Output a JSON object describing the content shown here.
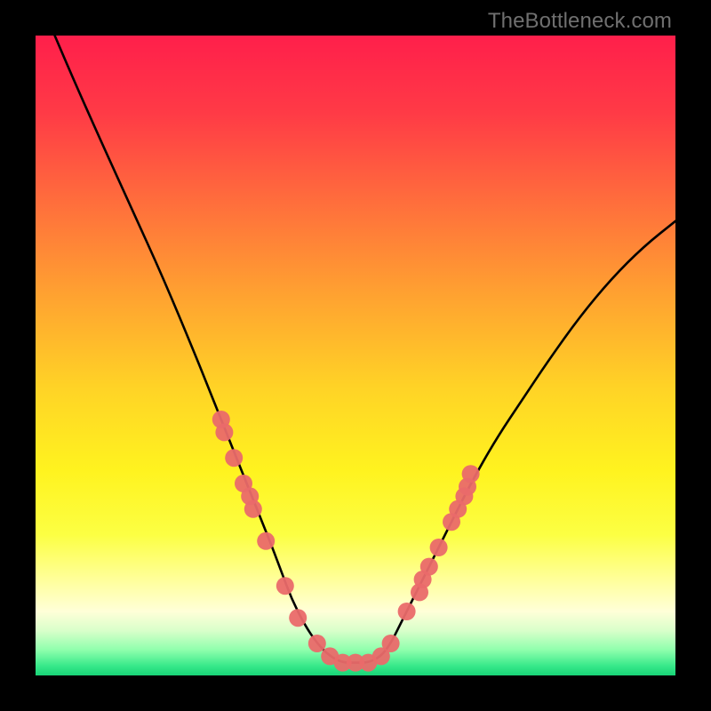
{
  "watermark": "TheBottleneck.com",
  "chart_data": {
    "type": "line",
    "title": "",
    "xlabel": "",
    "ylabel": "",
    "xlim": [
      0,
      100
    ],
    "ylim": [
      0,
      100
    ],
    "grid": false,
    "legend": false,
    "annotations": [],
    "series": [
      {
        "name": "bottleneck-curve",
        "color": "#000000",
        "x": [
          3,
          6,
          10,
          15,
          20,
          25,
          27,
          29,
          31,
          33,
          35,
          37,
          38.5,
          40,
          42,
          44,
          46,
          48,
          50,
          52,
          54,
          55.5,
          57,
          59,
          61,
          64,
          68,
          72,
          76,
          80,
          85,
          90,
          95,
          100
        ],
        "y": [
          100,
          93,
          84,
          73,
          62,
          50,
          45,
          40,
          35,
          30,
          25,
          20,
          16,
          12,
          8,
          5,
          3,
          2,
          2,
          2,
          3,
          5,
          8,
          12,
          16,
          22,
          30,
          37,
          43,
          49,
          56,
          62,
          67,
          71
        ]
      }
    ],
    "markers": [
      {
        "name": "data-dots",
        "color": "#ea6a6a",
        "shape": "circle",
        "radius_px": 10,
        "points": [
          {
            "x": 29,
            "y": 40
          },
          {
            "x": 29.5,
            "y": 38
          },
          {
            "x": 31,
            "y": 34
          },
          {
            "x": 32.5,
            "y": 30
          },
          {
            "x": 33.5,
            "y": 28
          },
          {
            "x": 34,
            "y": 26
          },
          {
            "x": 36,
            "y": 21
          },
          {
            "x": 39,
            "y": 14
          },
          {
            "x": 41,
            "y": 9
          },
          {
            "x": 44,
            "y": 5
          },
          {
            "x": 46,
            "y": 3
          },
          {
            "x": 48,
            "y": 2
          },
          {
            "x": 50,
            "y": 2
          },
          {
            "x": 52,
            "y": 2
          },
          {
            "x": 54,
            "y": 3
          },
          {
            "x": 55.5,
            "y": 5
          },
          {
            "x": 58,
            "y": 10
          },
          {
            "x": 60,
            "y": 13
          },
          {
            "x": 60.5,
            "y": 15
          },
          {
            "x": 61.5,
            "y": 17
          },
          {
            "x": 63,
            "y": 20
          },
          {
            "x": 65,
            "y": 24
          },
          {
            "x": 66,
            "y": 26
          },
          {
            "x": 67,
            "y": 28
          },
          {
            "x": 67.5,
            "y": 29.5
          },
          {
            "x": 68,
            "y": 31.5
          }
        ]
      }
    ],
    "gradient_stops": [
      {
        "offset": 0.0,
        "color": "#ff1f4b"
      },
      {
        "offset": 0.12,
        "color": "#ff3a46"
      },
      {
        "offset": 0.25,
        "color": "#ff6a3d"
      },
      {
        "offset": 0.4,
        "color": "#ffa031"
      },
      {
        "offset": 0.55,
        "color": "#ffd326"
      },
      {
        "offset": 0.68,
        "color": "#fff31f"
      },
      {
        "offset": 0.78,
        "color": "#fcff43"
      },
      {
        "offset": 0.85,
        "color": "#ffff9a"
      },
      {
        "offset": 0.9,
        "color": "#ffffd8"
      },
      {
        "offset": 0.93,
        "color": "#d9ffca"
      },
      {
        "offset": 0.96,
        "color": "#8fffad"
      },
      {
        "offset": 0.985,
        "color": "#38e98a"
      },
      {
        "offset": 1.0,
        "color": "#18d477"
      }
    ]
  }
}
